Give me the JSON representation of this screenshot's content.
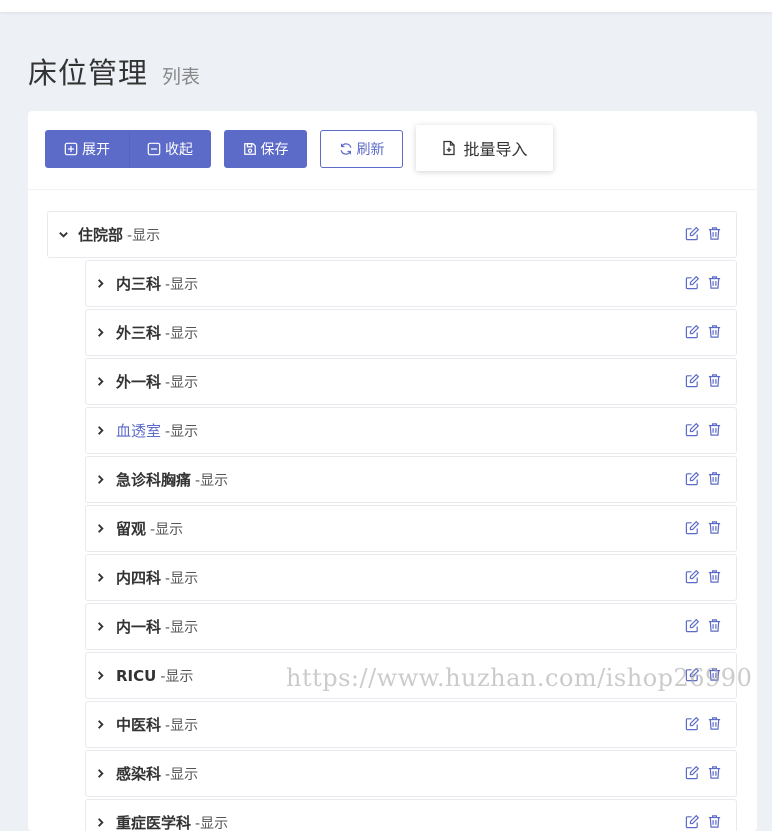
{
  "header": {
    "title": "床位管理",
    "subtitle": "列表"
  },
  "toolbar": {
    "expand_label": "展开",
    "collapse_label": "收起",
    "save_label": "保存",
    "refresh_label": "刷新",
    "import_label": "批量导入"
  },
  "tree": {
    "root": {
      "name": "住院部",
      "status": "-显示"
    },
    "children": [
      {
        "name": "内三科",
        "status": "-显示"
      },
      {
        "name": "外三科",
        "status": "-显示"
      },
      {
        "name": "外一科",
        "status": "-显示"
      },
      {
        "name": "血透室",
        "status": "-显示"
      },
      {
        "name": "急诊科胸痛",
        "status": "-显示"
      },
      {
        "name": "留观",
        "status": "-显示"
      },
      {
        "name": "内四科",
        "status": "-显示"
      },
      {
        "name": "内一科",
        "status": "-显示"
      },
      {
        "name": "RICU",
        "status": "-显示"
      },
      {
        "name": "中医科",
        "status": "-显示"
      },
      {
        "name": "感染科",
        "status": "-显示"
      },
      {
        "name": "重症医学科",
        "status": "-显示"
      }
    ]
  },
  "watermark": "https://www.huzhan.com/ishop26990",
  "colors": {
    "accent": "#5c6bc8",
    "background": "#edf1f6",
    "icon": "#5c6bc8"
  }
}
